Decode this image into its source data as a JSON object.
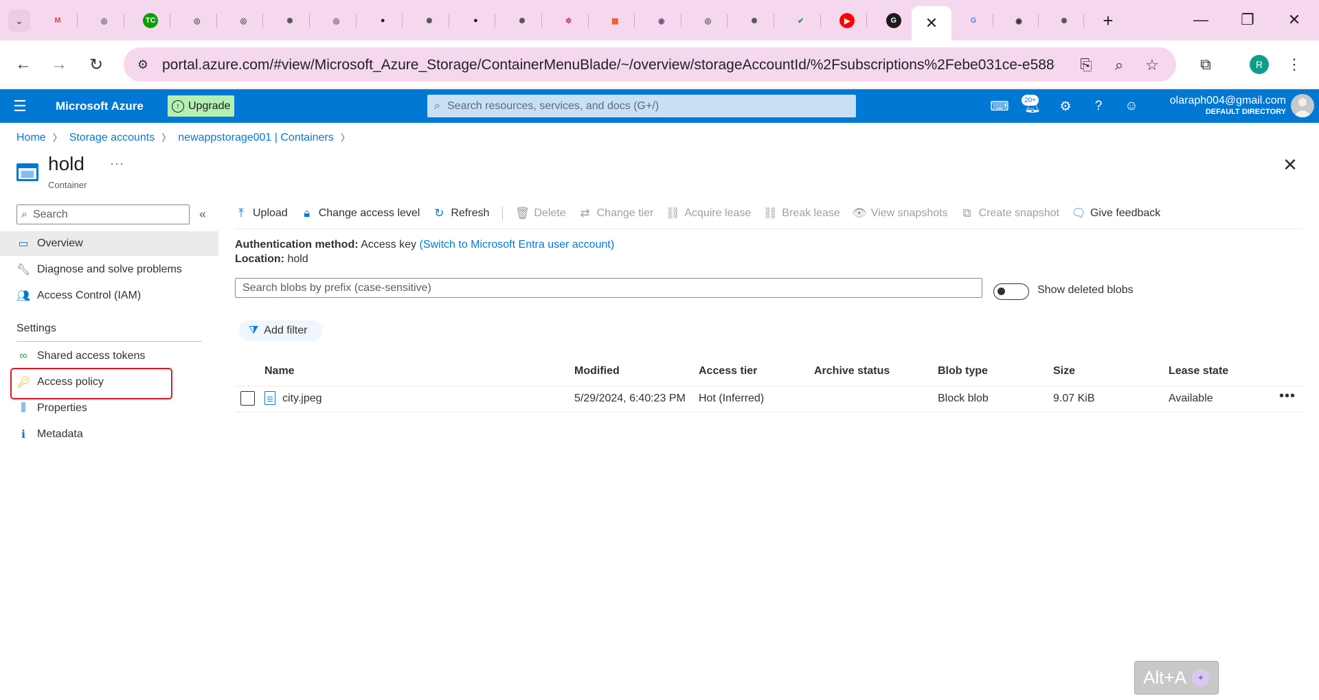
{
  "browser": {
    "tabs": [
      {
        "icon": "gmail-icon",
        "glyph": "M",
        "color": "#ea4335",
        "bg": "transparent"
      },
      {
        "icon": "openai-icon",
        "glyph": "◎",
        "color": "#555555",
        "bg": "transparent"
      },
      {
        "icon": "techcrunch-icon",
        "glyph": "TC",
        "color": "#ffffff",
        "bg": "#0a9e01"
      },
      {
        "icon": "site-icon",
        "glyph": "◎",
        "color": "#555555",
        "bg": "transparent"
      },
      {
        "icon": "site-icon",
        "glyph": "◎",
        "color": "#555555",
        "bg": "transparent"
      },
      {
        "icon": "chatgpt-icon",
        "glyph": "✺",
        "color": "#555555",
        "bg": "transparent"
      },
      {
        "icon": "site-icon",
        "glyph": "◎",
        "color": "#555555",
        "bg": "transparent"
      },
      {
        "icon": "github-icon",
        "glyph": "●",
        "color": "#111111",
        "bg": "transparent"
      },
      {
        "icon": "chatgpt-icon",
        "glyph": "✺",
        "color": "#555555",
        "bg": "transparent"
      },
      {
        "icon": "github-icon",
        "glyph": "●",
        "color": "#111111",
        "bg": "transparent"
      },
      {
        "icon": "chatgpt-icon",
        "glyph": "✺",
        "color": "#555555",
        "bg": "transparent"
      },
      {
        "icon": "slack-icon",
        "glyph": "✲",
        "color": "#e01e5a",
        "bg": "transparent"
      },
      {
        "icon": "microsoft-icon",
        "glyph": "▦",
        "color": "#f25022",
        "bg": "transparent"
      },
      {
        "icon": "site-icon",
        "glyph": "◉",
        "color": "#7a4a8a",
        "bg": "transparent"
      },
      {
        "icon": "openai-icon",
        "glyph": "◎",
        "color": "#555555",
        "bg": "transparent"
      },
      {
        "icon": "chatgpt-icon",
        "glyph": "✺",
        "color": "#555555",
        "bg": "transparent"
      },
      {
        "icon": "check-icon",
        "glyph": "✔",
        "color": "#0a9e4a",
        "bg": "transparent"
      },
      {
        "icon": "youtube-icon",
        "glyph": "▶",
        "color": "#ffffff",
        "bg": "#ff0000"
      },
      {
        "icon": "google-icon",
        "glyph": "G",
        "color": "#ffffff",
        "bg": "#1a1a1a"
      }
    ],
    "after_tabs": [
      {
        "icon": "google-icon",
        "glyph": "G",
        "color": "#4285f4",
        "bg": "transparent"
      },
      {
        "icon": "dev-icon",
        "glyph": "◉",
        "color": "#333333",
        "bg": "transparent"
      },
      {
        "icon": "chatgpt-icon",
        "glyph": "✺",
        "color": "#555555",
        "bg": "transparent"
      }
    ],
    "url": "portal.azure.com/#view/Microsoft_Azure_Storage/ContainerMenuBlade/~/overview/storageAccountId/%2Fsubscriptions%2Febe031ce-e588-...",
    "profile_initial": "R"
  },
  "azure": {
    "brand": "Microsoft Azure",
    "upgrade_label": "Upgrade",
    "search_placeholder": "Search resources, services, and docs (G+/)",
    "notification_count": "20+",
    "account_email": "olaraph004@gmail.com",
    "account_directory": "DEFAULT DIRECTORY"
  },
  "breadcrumb": [
    "Home",
    "Storage accounts",
    "newappstorage001 | Containers"
  ],
  "resource": {
    "title": "hold",
    "more": "···",
    "subtitle": "Container"
  },
  "menu": {
    "search_placeholder": "Search",
    "items_top": [
      {
        "label": "Overview",
        "icon": "overview-icon",
        "glyph": "▭",
        "color": "#0078d4",
        "active": true
      },
      {
        "label": "Diagnose and solve problems",
        "icon": "wrench-icon",
        "glyph": "🔧︎",
        "color": "#605e5c",
        "active": false
      },
      {
        "label": "Access Control (IAM)",
        "icon": "people-icon",
        "glyph": "👥︎",
        "color": "#0078d4",
        "active": false
      }
    ],
    "section_label": "Settings",
    "items_settings": [
      {
        "label": "Shared access tokens",
        "icon": "link-icon",
        "glyph": "∞",
        "color": "#3a9b3a",
        "active": false
      },
      {
        "label": "Access policy",
        "icon": "key-icon",
        "glyph": "🔑︎",
        "color": "#e8b10c",
        "active": false
      },
      {
        "label": "Properties",
        "icon": "properties-icon",
        "glyph": "⫼",
        "color": "#0078d4",
        "active": false
      },
      {
        "label": "Metadata",
        "icon": "info-icon",
        "glyph": "ℹ",
        "color": "#0078d4",
        "active": false
      }
    ]
  },
  "toolbar": {
    "items": [
      {
        "label": "Upload",
        "icon": "upload-icon",
        "glyph": "⤒",
        "disabled": false
      },
      {
        "label": "Change access level",
        "icon": "lock-icon",
        "glyph": "🔒︎",
        "disabled": false
      },
      {
        "label": "Refresh",
        "icon": "refresh-icon",
        "glyph": "↻",
        "disabled": false
      },
      {
        "sep": true
      },
      {
        "label": "Delete",
        "icon": "trash-icon",
        "glyph": "🗑︎",
        "disabled": true
      },
      {
        "label": "Change tier",
        "icon": "swap-icon",
        "glyph": "⇄",
        "disabled": true
      },
      {
        "label": "Acquire lease",
        "icon": "chain-icon",
        "glyph": "⛓︎",
        "disabled": true
      },
      {
        "label": "Break lease",
        "icon": "broken-chain-icon",
        "glyph": "⛓︎",
        "disabled": true
      },
      {
        "label": "View snapshots",
        "icon": "eye-icon",
        "glyph": "👁︎",
        "disabled": true
      },
      {
        "label": "Create snapshot",
        "icon": "snapshot-icon",
        "glyph": "⧉",
        "disabled": true
      },
      {
        "label": "Give feedback",
        "icon": "feedback-icon",
        "glyph": "🗨︎",
        "disabled": false
      }
    ]
  },
  "content": {
    "auth_label": "Authentication method:",
    "auth_value": "Access key",
    "auth_link": "(Switch to Microsoft Entra user account)",
    "location_label": "Location:",
    "location_value": "hold",
    "blob_search_placeholder": "Search blobs by prefix (case-sensitive)",
    "show_deleted_label": "Show deleted blobs",
    "add_filter_label": "Add filter"
  },
  "table": {
    "columns": [
      "Name",
      "Modified",
      "Access tier",
      "Archive status",
      "Blob type",
      "Size",
      "Lease state"
    ],
    "rows": [
      {
        "name": "city.jpeg",
        "modified": "5/29/2024, 6:40:23 PM",
        "access_tier": "Hot (Inferred)",
        "archive_status": "",
        "blob_type": "Block blob",
        "size": "9.07 KiB",
        "lease_state": "Available"
      }
    ]
  },
  "overlay": {
    "shortcut_label": "Alt+A"
  }
}
